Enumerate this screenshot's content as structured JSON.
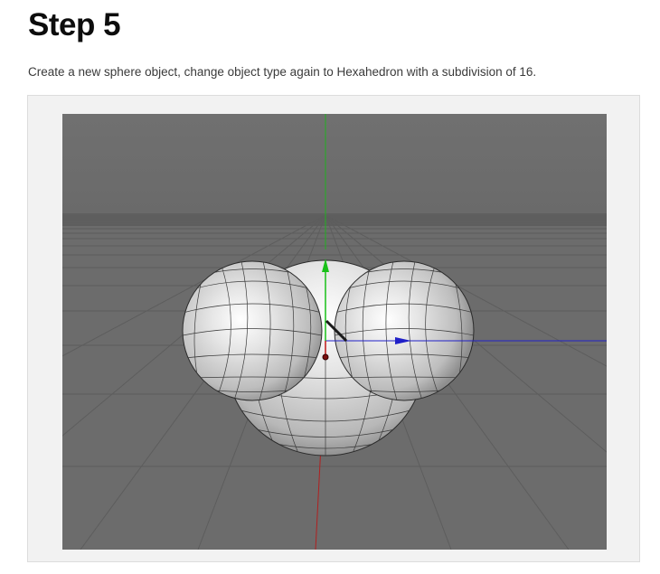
{
  "step": {
    "title": "Step 5",
    "description": "Create a new sphere object, change object type again to Hexahedron with a subdivision of 16."
  },
  "viewport": {
    "background_color": "#6e6e6e",
    "floor_grid_color": "#606060",
    "horizon_color": "#5c5c5c",
    "axis_colors": {
      "x": "#2020c8",
      "y": "#18c018",
      "z": "#c01818"
    },
    "objects": [
      "sphere-hexahedron-bottom",
      "sphere-hexahedron-left",
      "sphere-hexahedron-right"
    ],
    "object_type": "Hexahedron",
    "subdivision": 16
  }
}
